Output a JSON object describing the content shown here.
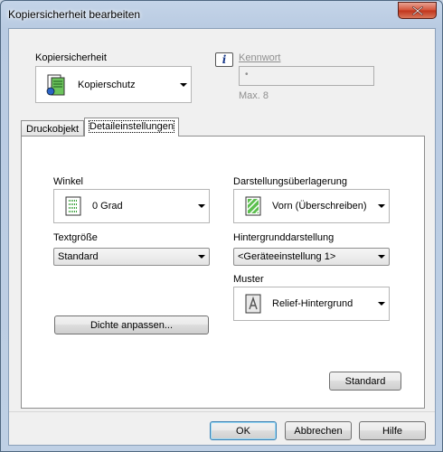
{
  "window": {
    "title": "Kopiersicherheit bearbeiten"
  },
  "header": {
    "copy_security_label": "Kopiersicherheit",
    "copy_security_value": "Kopierschutz",
    "password_label": "Kennwort",
    "password_value": "•",
    "password_max": "Max. 8"
  },
  "tabs": [
    {
      "label": "Druckobjekt"
    },
    {
      "label": "Detaileinstellungen"
    }
  ],
  "details": {
    "angle_label": "Winkel",
    "angle_value": "0 Grad",
    "text_size_label": "Textgröße",
    "text_size_value": "Standard",
    "overlay_label": "Darstellungsüberlagerung",
    "overlay_value": "Vorn (Überschreiben)",
    "background_label": "Hintergrunddarstellung",
    "background_value": "<Geräteeinstellung 1>",
    "pattern_label": "Muster",
    "pattern_value": "Relief-Hintergrund",
    "density_button": "Dichte anpassen...",
    "standard_button": "Standard"
  },
  "footer": {
    "ok": "OK",
    "cancel": "Abbrechen",
    "help": "Hilfe"
  },
  "icons": {
    "close": "close-icon",
    "info": "info-icon",
    "copy_protect": "copy-protect-icon",
    "angle": "angle-icon",
    "overlay": "overlay-icon",
    "pattern": "pattern-icon"
  }
}
